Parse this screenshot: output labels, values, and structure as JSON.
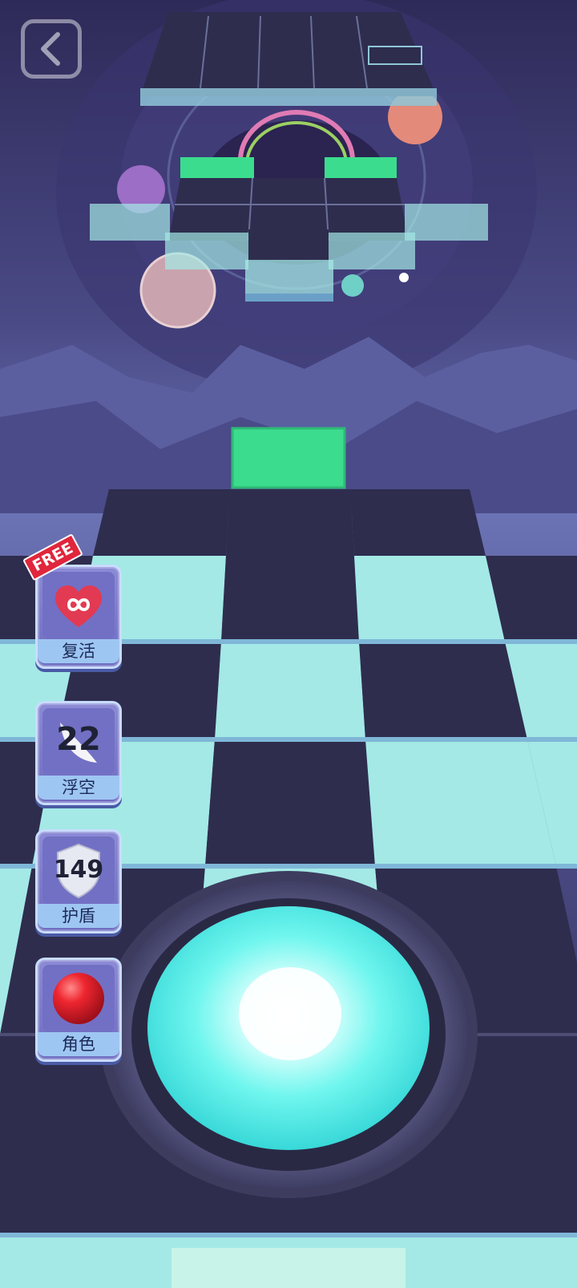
{
  "powerups": [
    {
      "label": "复活",
      "badge": "FREE",
      "icon": "heart-infinity-icon"
    },
    {
      "label": "浮空",
      "count": "22",
      "icon": "feather-icon"
    },
    {
      "label": "护盾",
      "count": "149",
      "icon": "shield-icon"
    },
    {
      "label": "角色",
      "icon": "red-ball-icon"
    }
  ],
  "back": {
    "icon": "chevron-left-icon"
  },
  "colors": {
    "tile_dark": "#2e2d4e",
    "tile_light": "#a4e9e6",
    "tile_green": "#3bdc8e",
    "ball": "#5ff3ec"
  }
}
